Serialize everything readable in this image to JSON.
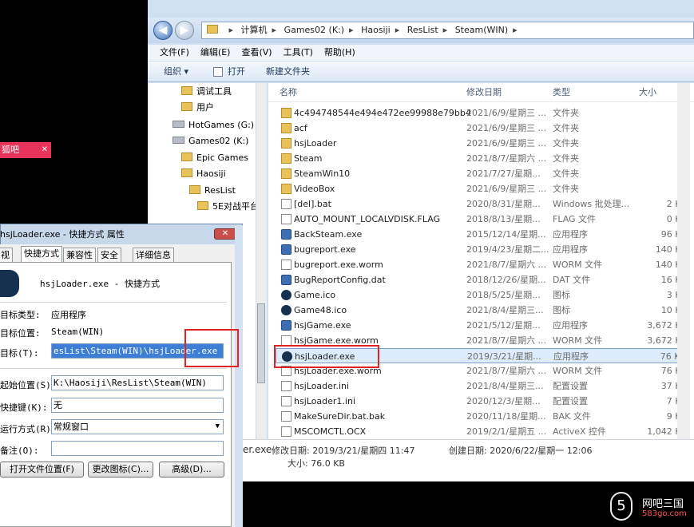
{
  "pink_tab": {
    "label": "狐吧",
    "close": "✕"
  },
  "explorer": {
    "breadcrumb": [
      "计算机",
      "Games02 (K:)",
      "Haosiji",
      "ResList",
      "Steam(WIN)"
    ],
    "menu": [
      "文件(F)",
      "编辑(E)",
      "查看(V)",
      "工具(T)",
      "帮助(H)"
    ],
    "toolbar": {
      "organize": "组织 ▾",
      "open": "打开",
      "new_folder": "新建文件夹"
    },
    "tree": [
      {
        "label": "调试工具",
        "type": "folder"
      },
      {
        "label": "用户",
        "type": "folder"
      },
      {
        "label": "HotGames (G:)",
        "type": "drive"
      },
      {
        "label": "Games02 (K:)",
        "type": "drive"
      },
      {
        "label": "Epic Games",
        "type": "folder"
      },
      {
        "label": "Haosiji",
        "type": "folder"
      },
      {
        "label": "ResList",
        "type": "folder"
      },
      {
        "label": "5E对战平台",
        "type": "folder"
      }
    ],
    "columns": {
      "name": "名称",
      "date": "修改日期",
      "type": "类型",
      "size": "大小"
    },
    "files": [
      {
        "name": "4c494748544e494e472ee99988e79bb4",
        "date": "2021/6/9/星期三 ...",
        "type": "文件夹",
        "size": "",
        "icon": "folder"
      },
      {
        "name": "acf",
        "date": "2021/6/9/星期三 ...",
        "type": "文件夹",
        "size": "",
        "icon": "folder"
      },
      {
        "name": "hsjLoader",
        "date": "2021/6/9/星期三 ...",
        "type": "文件夹",
        "size": "",
        "icon": "folder"
      },
      {
        "name": "Steam",
        "date": "2021/8/7/星期六 ...",
        "type": "文件夹",
        "size": "",
        "icon": "folder"
      },
      {
        "name": "SteamWin10",
        "date": "2021/7/27/星期...",
        "type": "文件夹",
        "size": "",
        "icon": "folder"
      },
      {
        "name": "VideoBox",
        "date": "2021/6/9/星期三 ...",
        "type": "文件夹",
        "size": "",
        "icon": "folder"
      },
      {
        "name": "[del].bat",
        "date": "2020/8/31/星期...",
        "type": "Windows 批处理...",
        "size": "2 KB",
        "icon": "file"
      },
      {
        "name": "AUTO_MOUNT_LOCALVDISK.FLAG",
        "date": "2018/8/13/星期...",
        "type": "FLAG 文件",
        "size": "0 KB",
        "icon": "file"
      },
      {
        "name": "BackSteam.exe",
        "date": "2015/12/14/星期...",
        "type": "应用程序",
        "size": "96 KB",
        "icon": "app"
      },
      {
        "name": "bugreport.exe",
        "date": "2019/4/23/星期二...",
        "type": "应用程序",
        "size": "140 KB",
        "icon": "app"
      },
      {
        "name": "bugreport.exe.worm",
        "date": "2021/8/7/星期六 ...",
        "type": "WORM 文件",
        "size": "140 KB",
        "icon": "file"
      },
      {
        "name": "BugReportConfig.dat",
        "date": "2018/12/26/星期...",
        "type": "DAT 文件",
        "size": "16 KB",
        "icon": "app"
      },
      {
        "name": "Game.ico",
        "date": "2018/5/25/星期...",
        "type": "图标",
        "size": "3 KB",
        "icon": "steam"
      },
      {
        "name": "Game48.ico",
        "date": "2021/8/4/星期三...",
        "type": "图标",
        "size": "10 KB",
        "icon": "steam"
      },
      {
        "name": "hsjGame.exe",
        "date": "2021/5/12/星期...",
        "type": "应用程序",
        "size": "3,672 KB",
        "icon": "app"
      },
      {
        "name": "hsjGame.exe.worm",
        "date": "2021/8/7/星期六 ...",
        "type": "WORM 文件",
        "size": "3,672 KB",
        "icon": "file"
      },
      {
        "name": "hsjLoader.exe",
        "date": "2019/3/21/星期...",
        "type": "应用程序",
        "size": "76 KB",
        "icon": "steam",
        "selected": true
      },
      {
        "name": "hsjLoader.exe.worm",
        "date": "2021/8/7/星期六 ...",
        "type": "WORM 文件",
        "size": "76 KB",
        "icon": "file"
      },
      {
        "name": "hsjLoader.ini",
        "date": "2021/8/4/星期三...",
        "type": "配置设置",
        "size": "37 KB",
        "icon": "file"
      },
      {
        "name": "hsjLoader1.ini",
        "date": "2020/12/3/星期...",
        "type": "配置设置",
        "size": "7 KB",
        "icon": "file"
      },
      {
        "name": "MakeSureDir.bat.bak",
        "date": "2020/11/18/星期...",
        "type": "BAK 文件",
        "size": "9 KB",
        "icon": "file"
      },
      {
        "name": "MSCOMCTL.OCX",
        "date": "2019/2/1/星期五 ...",
        "type": "ActiveX 控件",
        "size": "1,042 KB",
        "icon": "file"
      }
    ],
    "details": {
      "name_fragment": "er.exe",
      "modified": "修改日期: 2019/3/21/星期四 11:47",
      "created": "创建日期: 2020/6/22/星期一 12:06",
      "size": "大小: 76.0 KB"
    }
  },
  "props_dialog": {
    "title": "hsjLoader.exe - 快捷方式 属性",
    "close": "✕",
    "tabs": [
      "视",
      "快捷方式",
      "兼容性",
      "安全",
      "详细信息"
    ],
    "header_name": "hsjLoader.exe - 快捷方式",
    "fields": {
      "target_type_label": "目标类型:",
      "target_type": "应用程序",
      "target_loc_label": "目标位置:",
      "target_loc": "Steam(WIN)",
      "target_label": "目标(T):",
      "target": "esList\\Steam(WIN)\\hsjLoader.exe /nomenu",
      "start_label": "起始位置(S):",
      "start": "K:\\Haosiji\\ResList\\Steam(WIN)",
      "hotkey_label": "快捷键(K):",
      "hotkey": "无",
      "run_label": "运行方式(R):",
      "run": "常规窗口",
      "comment_label": "备注(O):",
      "comment": ""
    },
    "buttons": {
      "open_location": "打开文件位置(F)",
      "change_icon": "更改图标(C)...",
      "advanced": "高级(D)..."
    }
  },
  "logo": {
    "mark": "5",
    "title": "网吧三国",
    "site": "583go.com"
  },
  "colors": {
    "highlight_red": "#e02424",
    "selection_blue": "#dcecfc",
    "pink": "#e8345a"
  }
}
